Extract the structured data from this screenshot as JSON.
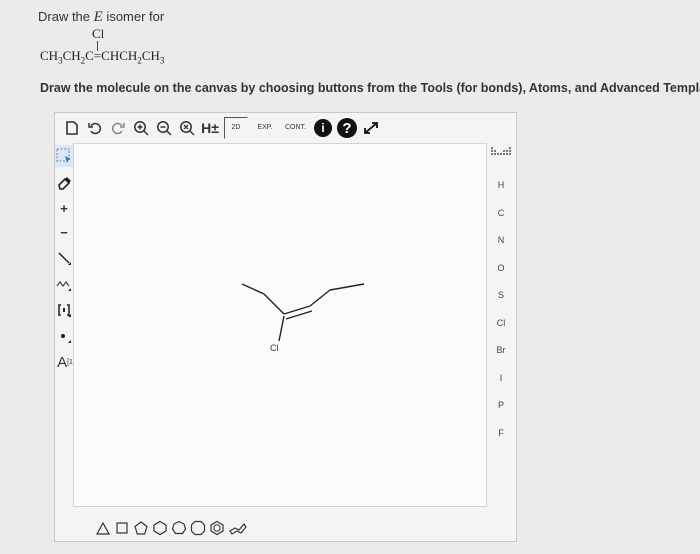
{
  "question": {
    "prefix": "Draw the ",
    "isomer": "E",
    "suffix": " isomer for"
  },
  "formula": {
    "substituent": "Cl",
    "main": "CH3CH2C=CHCH2CH3"
  },
  "instruction": "Draw the molecule on the canvas by choosing buttons from the Tools (for bonds), Atoms, and Advanced Template",
  "toolbar": {
    "h_toggle": "H±",
    "twod": "2D",
    "exp": "EXP.",
    "cont": "CONT."
  },
  "left_tools": {
    "plus": "+",
    "minus": "−",
    "charge_label": "A",
    "charge_sup": "[1]"
  },
  "atoms": [
    "H",
    "C",
    "N",
    "O",
    "S",
    "Cl",
    "Br",
    "I",
    "P",
    "F"
  ],
  "molecule": {
    "atom_label": "Cl"
  },
  "colors": {
    "background": "#ecebea",
    "canvas": "#fbfbfb",
    "toolbar_icon": "#333333"
  }
}
